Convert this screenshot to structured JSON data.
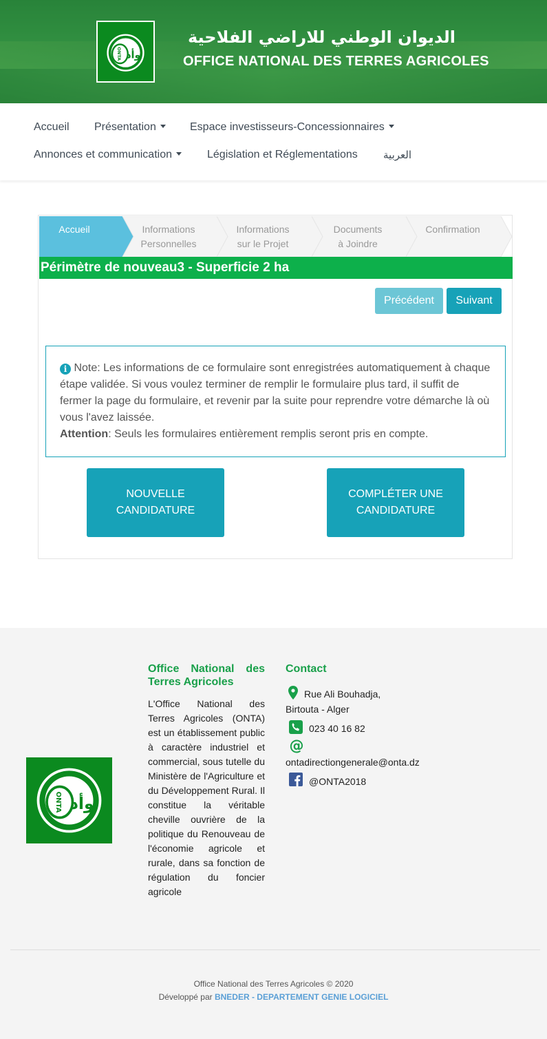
{
  "header": {
    "title_ar": "الديوان الوطني للاراضي الفلاحية",
    "title_fr": "OFFICE NATIONAL DES TERRES AGRICOLES",
    "logo_text_ar": "الديوان الوطني للأراضي الفلاحية",
    "logo_text_fr": "OFFICE NATIONAL DES TERRES AGRICOLES",
    "logo_abbr": "ONTA",
    "logo_glyphs": "وأد"
  },
  "nav": {
    "accueil": "Accueil",
    "presentation": "Présentation",
    "espace": "Espace investisseurs-Concessionnaires",
    "annonces": "Annonces et communication",
    "legislation": "Législation et Réglementations",
    "arabic": "العربية"
  },
  "wizard": {
    "steps": [
      {
        "line1": "Accueil",
        "line2": ""
      },
      {
        "line1": "Informations",
        "line2": "Personnelles"
      },
      {
        "line1": "Informations",
        "line2": "sur le Projet"
      },
      {
        "line1": "Documents",
        "line2": "à Joindre"
      },
      {
        "line1": "Confirmation",
        "line2": ""
      }
    ],
    "perimeter": "Périmètre de nouveau3 - Superficie 2 ha",
    "prev_label": "Précédent",
    "next_label": "Suivant",
    "note_label": "Note",
    "note_text": ": Les informations de ce formulaire sont enregistrées automatiquement à chaque étape validée. Si vous voulez terminer de remplir le formulaire plus tard, il suffit de fermer la page du formulaire, et revenir par la suite pour reprendre votre démarche là où vous l'avez laissée.",
    "attention_label": "Attention",
    "attention_text": ": Seuls les formulaires entièrement remplis seront pris en compte.",
    "new_line1": "NOUVELLE",
    "new_line2": "CANDIDATURE",
    "complete_line1": "COMPLÉTER UNE",
    "complete_line2": "CANDIDATURE"
  },
  "footer": {
    "about_title": "Office National des Terres Agricoles",
    "about_text": "L'Office National des Terres Agricoles (ONTA) est un établissement public à caractère industriel et commercial, sous tutelle du Ministère de l'Agriculture et du Développement Rural. Il constitue la véritable cheville ouvrière de la politique du Renouveau de l'économie agricole et rurale, dans sa fonction de régulation du foncier agricole",
    "contact_title": "Contact",
    "address1": "Rue Ali Bouhadja,",
    "address2": "Birtouta - Alger",
    "phone": "023 40 16 82",
    "email": "ontadirectiongenerale@onta.dz",
    "facebook": "@ONTA2018",
    "copyright": "Office National des Terres Agricoles © 2020",
    "dev_prefix": "Développé par ",
    "dev_link": "BNEDER - DEPARTEMENT GENIE LOGICIEL"
  },
  "colors": {
    "brand_green": "#0db04b",
    "accent_teal": "#17a2b8",
    "step_active": "#5bc0de"
  }
}
